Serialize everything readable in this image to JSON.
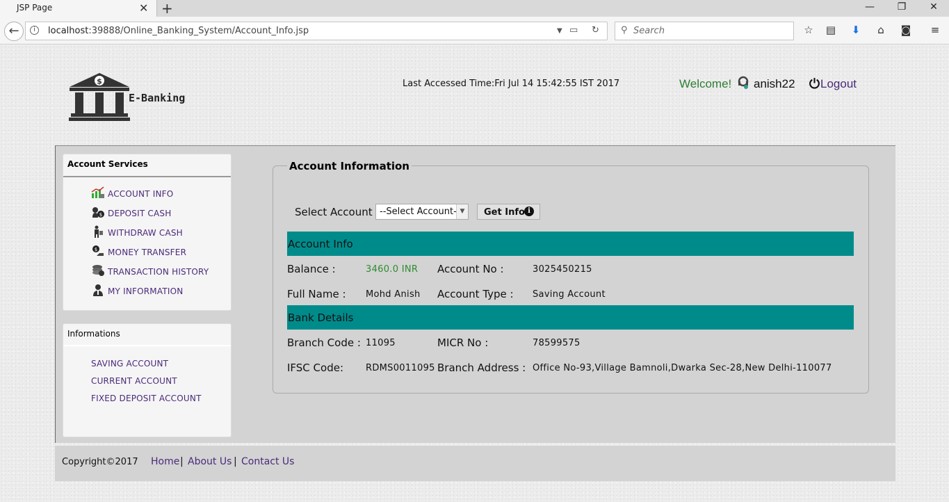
{
  "browser": {
    "tab_title": "JSP Page",
    "url_host": "localhost",
    "url_rest": ":39888/Online_Banking_System/Account_Info.jsp",
    "search_placeholder": "Search"
  },
  "header": {
    "logo_text": "E-Banking",
    "last_access": "Last Accessed Time:Fri Jul 14 15:42:55 IST 2017",
    "welcome": "Welcome!",
    "username": "anish22",
    "logout": "Logout"
  },
  "sidebar": {
    "services_title": "Account Services",
    "services": [
      {
        "label": "ACCOUNT INFO",
        "icon": "chart-money-icon"
      },
      {
        "label": "DEPOSIT CASH",
        "icon": "money-bag-icon"
      },
      {
        "label": "WITHDRAW CASH",
        "icon": "person-money-icon"
      },
      {
        "label": "MONEY TRANSFER",
        "icon": "coin-hand-icon"
      },
      {
        "label": "TRANSACTION HISTORY",
        "icon": "coins-stack-icon"
      },
      {
        "label": "MY INFORMATION",
        "icon": "person-icon"
      }
    ],
    "info_title": "Informations",
    "info_links": [
      "SAVING ACCOUNT",
      "CURRENT ACCOUNT",
      "FIXED DEPOSIT ACCOUNT"
    ]
  },
  "account": {
    "legend": "Account Information",
    "select_label": "Select Account",
    "select_value": "--Select Account--",
    "button": "Get Info",
    "section1": "Account Info",
    "balance_label": "Balance :",
    "balance_value": "3460.0 INR",
    "accno_label": "Account No :",
    "accno_value": "3025450215",
    "fullname_label": "Full Name :",
    "fullname_value": "Mohd Anish",
    "acctype_label": "Account Type :",
    "acctype_value": "Saving Account",
    "section2": "Bank Details",
    "branchcode_label": "Branch Code :",
    "branchcode_value": "11095",
    "micr_label": "MICR No :",
    "micr_value": "78599575",
    "ifsc_label": "IFSC Code:",
    "ifsc_value": "RDMS0011095",
    "address_label": "Branch Address :",
    "address_value": "Office No-93,Village Bamnoli,Dwarka Sec-28,New Delhi-110077"
  },
  "footer": {
    "copyright": "Copyright©2017",
    "links": [
      "Home",
      "About Us",
      "Contact Us"
    ],
    "separator": "|"
  },
  "colors": {
    "teal_bar": "#008b8b",
    "link_purple": "#4a2a7a",
    "welcome_green": "#2e7d32",
    "balance_green": "#2e8b2e"
  }
}
